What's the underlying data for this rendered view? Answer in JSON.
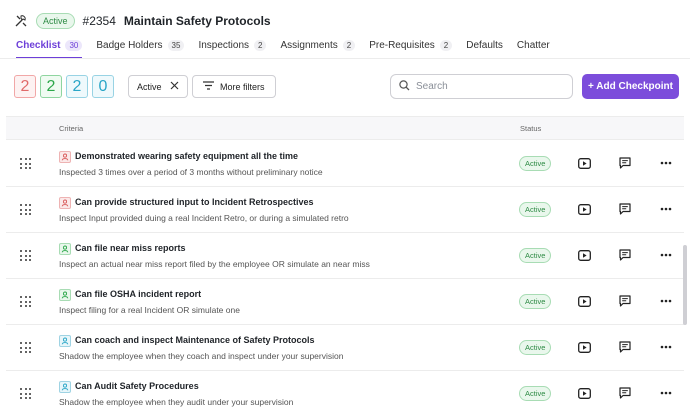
{
  "header": {
    "status": "Active",
    "id": "#2354",
    "title": "Maintain Safety Protocols"
  },
  "tabs": [
    {
      "label": "Checklist",
      "count": "30"
    },
    {
      "label": "Badge Holders",
      "count": "35"
    },
    {
      "label": "Inspections",
      "count": "2"
    },
    {
      "label": "Assignments",
      "count": "2"
    },
    {
      "label": "Pre-Requisites",
      "count": "2"
    },
    {
      "label": "Defaults",
      "count": ""
    },
    {
      "label": "Chatter",
      "count": ""
    }
  ],
  "counters": [
    "2",
    "2",
    "2",
    "0"
  ],
  "filters": {
    "chip_label": "Active",
    "more_label": "More filters"
  },
  "search": {
    "placeholder": "Search"
  },
  "add_button": "+ Add Checkpoint",
  "table": {
    "criteria_header": "Criteria",
    "status_header": "Status"
  },
  "rows": [
    {
      "title": "Demonstrated wearing safety equipment all the time",
      "desc": "Inspected 3 times over a period of 3 months without preliminary notice",
      "status": "Active"
    },
    {
      "title": "Can provide structured input to Incident Retrospectives",
      "desc": "Inspect Input provided duing a real Incident Retro, or during a simulated retro",
      "status": "Active"
    },
    {
      "title": "Can file near miss reports",
      "desc": "Inspect an actual near miss report filed by the employee OR simulate an near miss",
      "status": "Active"
    },
    {
      "title": "Can file OSHA incident report",
      "desc": "Inspect filing for a real Incident OR simulate one",
      "status": "Active"
    },
    {
      "title": "Can coach and inspect Maintenance of Safety Protocols",
      "desc": "Shadow the employee when they coach and inspect under your supervision",
      "status": "Active"
    },
    {
      "title": "Can Audit Safety Procedures",
      "desc": "Shadow the employee when they audit under your supervision",
      "status": "Active"
    }
  ],
  "colors": {
    "accent": "#7c4ddb",
    "active_green": "#2e8b45"
  }
}
